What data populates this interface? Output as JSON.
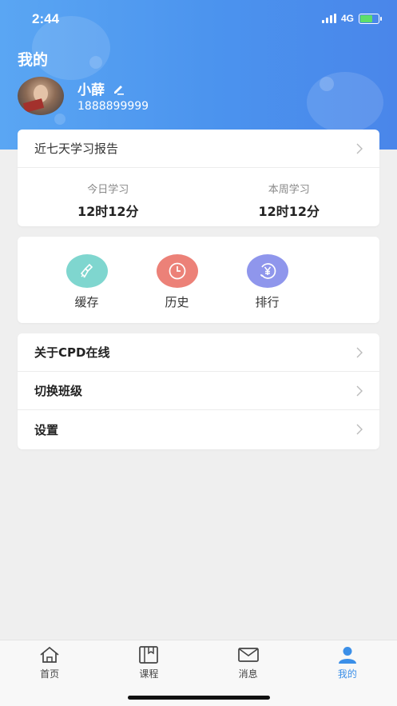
{
  "status": {
    "time": "2:44",
    "network": "4G"
  },
  "header": {
    "title": "我的"
  },
  "user": {
    "name": "小薛",
    "phone": "1888899999"
  },
  "report": {
    "title": "近七天学习报告",
    "today_label": "今日学习",
    "today_value": "12时12分",
    "week_label": "本周学习",
    "week_value": "12时12分"
  },
  "tools": [
    {
      "label": "缓存",
      "icon": "broom-icon",
      "color": "#7fd6cf"
    },
    {
      "label": "历史",
      "icon": "clock-icon",
      "color": "#ec8178"
    },
    {
      "label": "排行",
      "icon": "yen-icon",
      "color": "#8f96ec"
    }
  ],
  "menu": [
    {
      "label": "关于CPD在线"
    },
    {
      "label": "切换班级"
    },
    {
      "label": "设置"
    }
  ],
  "tabbar": {
    "items": [
      {
        "label": "首页",
        "icon": "home-icon"
      },
      {
        "label": "课程",
        "icon": "book-icon"
      },
      {
        "label": "消息",
        "icon": "mail-icon"
      },
      {
        "label": "我的",
        "icon": "user-icon"
      }
    ],
    "active": "我的",
    "active_color": "#3b8fe8"
  }
}
